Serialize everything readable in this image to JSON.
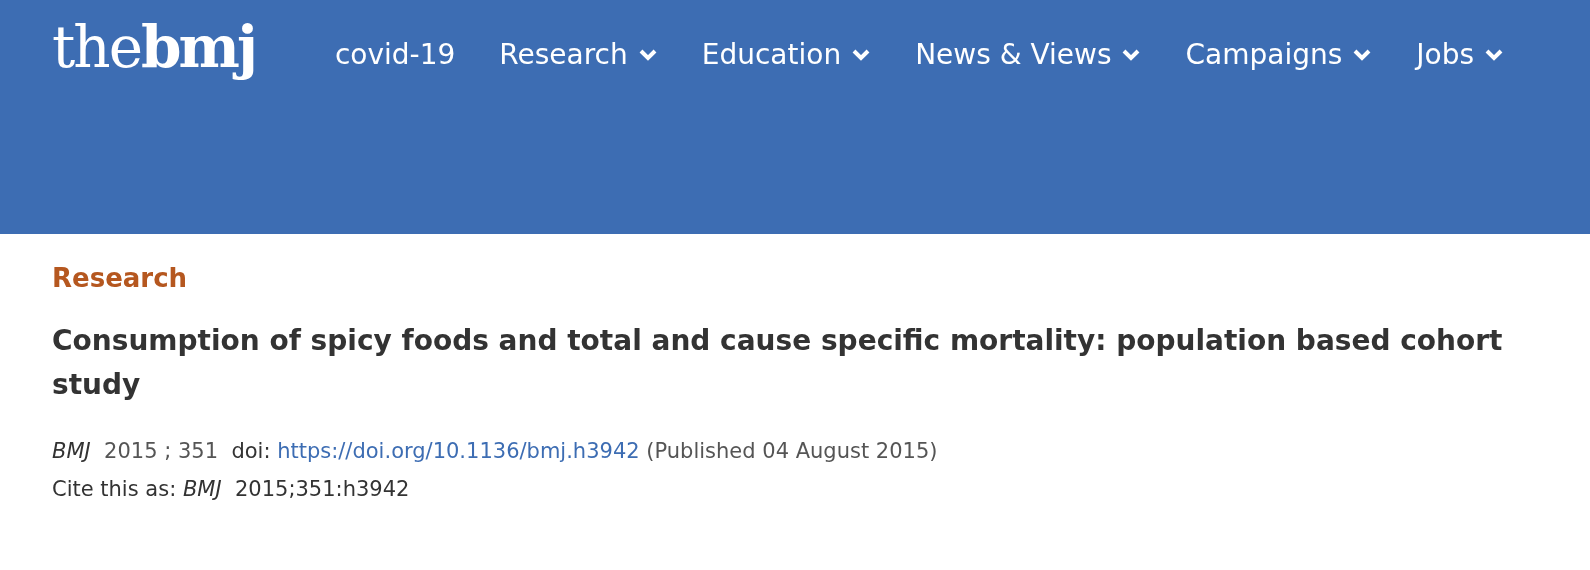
{
  "header": {
    "logo": "the**bmj**",
    "nav": [
      {
        "label": "covid-19",
        "has_menu": false
      },
      {
        "label": "Research",
        "has_menu": true
      },
      {
        "label": "Education",
        "has_menu": true
      },
      {
        "label": "News & Views",
        "has_menu": true
      },
      {
        "label": "Campaigns",
        "has_menu": true
      },
      {
        "label": "Jobs",
        "has_menu": true
      }
    ]
  },
  "article": {
    "section": "Research",
    "title": "Consumption of spicy foods and total and cause specific mortality: population based cohort study",
    "citation": {
      "journal": "BMJ",
      "volume": "2015 ; 351",
      "doi_label": "doi:",
      "doi_url": "https://doi.org/10.1136/bmj.h3942",
      "published": "(Published 04 August 2015)"
    },
    "cite_as": {
      "label": "Cite this as:",
      "journal": "BMJ",
      "reference": "2015;351:h3942"
    }
  }
}
